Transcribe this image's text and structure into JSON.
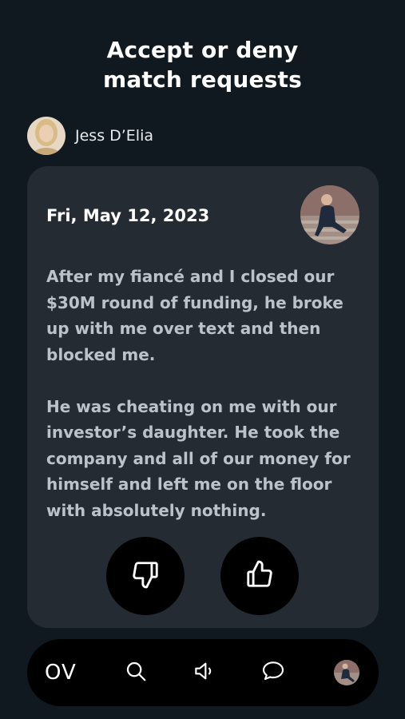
{
  "header": {
    "title": "Accept or deny\nmatch requests"
  },
  "sender": {
    "name": "Jess D’Elia"
  },
  "card": {
    "date": "Fri, May 12, 2023",
    "paragraphs": [
      "After my fiancé and I closed our $30M round of funding, he broke up with me over text and then blocked me.",
      "He was cheating on me with our investor’s daughter. He took the company and all of our money for himself and left me on the floor with absolutely nothing."
    ],
    "deny_icon": "thumbs-down-icon",
    "accept_icon": "thumbs-up-icon"
  },
  "navbar": {
    "logo": "OV",
    "icons": [
      "search-icon",
      "speaker-icon",
      "chat-bubble-icon",
      "profile-avatar"
    ]
  },
  "colors": {
    "background": "#111920",
    "card": "#252b33",
    "button": "#000000",
    "text": "#ffffff",
    "message_text": "#bcc2c9"
  }
}
